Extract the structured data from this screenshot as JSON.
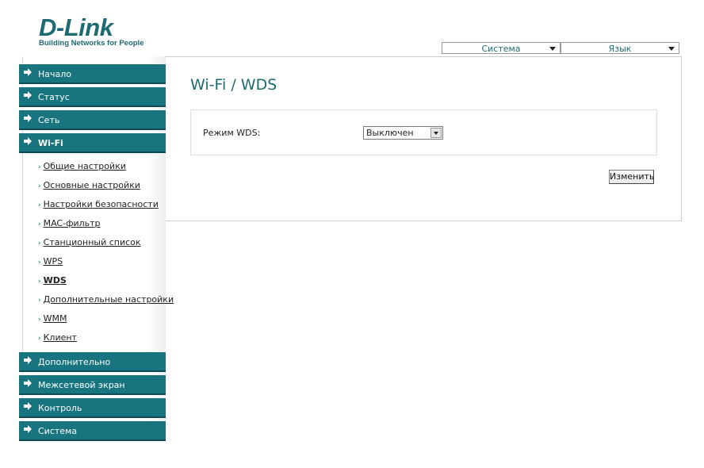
{
  "logo": {
    "brand": "D-Link",
    "tagline": "Building Networks for People"
  },
  "top_menu": {
    "system_label": "Система",
    "language_label": "Язык"
  },
  "sidebar": {
    "items_top": [
      {
        "label": "Начало"
      },
      {
        "label": "Статус"
      },
      {
        "label": "Сеть"
      },
      {
        "label": "Wi-Fi"
      }
    ],
    "wifi_subitems": [
      {
        "label": "Общие настройки"
      },
      {
        "label": "Основные настройки"
      },
      {
        "label": "Настройки безопасности"
      },
      {
        "label": "MAC-фильтр"
      },
      {
        "label": "Станционный список"
      },
      {
        "label": "WPS"
      },
      {
        "label": "WDS"
      },
      {
        "label": "Дополнительные настройки"
      },
      {
        "label": "WMM"
      },
      {
        "label": "Клиент"
      }
    ],
    "items_bottom": [
      {
        "label": "Дополнительно"
      },
      {
        "label": "Межсетевой экран"
      },
      {
        "label": "Контроль"
      },
      {
        "label": "Система"
      }
    ],
    "sub_bullet": "›"
  },
  "main": {
    "title": "Wi-Fi  / WDS",
    "wds_mode_label": "Режим WDS:",
    "wds_mode_value": "Выключен",
    "apply_button": "Изменить"
  },
  "colors": {
    "accent": "#187580",
    "title": "#1d6a73"
  }
}
